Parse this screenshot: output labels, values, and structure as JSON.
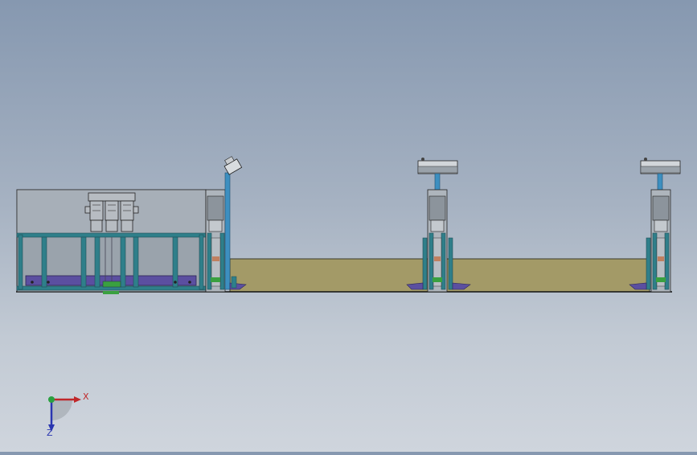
{
  "viewport": {
    "background_top": "#8698b0",
    "background_bottom": "#cfd5dd"
  },
  "colors": {
    "frame_teal": "#2f7f8a",
    "frame_dark": "#1e4f57",
    "enclosure_gray": "#9aa3ac",
    "floor_olive": "#a39a67",
    "base_purple": "#5b4fa0",
    "pillar_blue": "#3d8fc0",
    "axis_x": "#c0282a",
    "axis_y": "#2aa040",
    "axis_z": "#2a36b0"
  },
  "triad": {
    "x_label": "X",
    "z_label": "Z",
    "icon": "coordinate-triad-icon"
  }
}
